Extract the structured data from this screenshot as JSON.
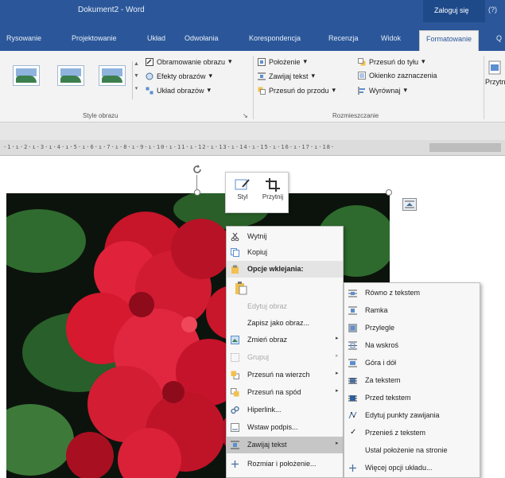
{
  "window": {
    "title": "Dokument2 - Word",
    "login_label": "Zaloguj się",
    "extra_label": "(?)"
  },
  "tabs": [
    "Rysowanie",
    "Projektowanie",
    "Układ",
    "Odwołania",
    "Korespondencja",
    "Recenzja",
    "Widok",
    "Formatowanie"
  ],
  "tab_partial": "Q",
  "ribbon": {
    "picture_styles_group": "Style obrazu",
    "arrange_group": "Rozmieszczanie",
    "border_label": "Obramowanie obrazu",
    "effects_label": "Efekty obrazów",
    "layout_label": "Układ obrazów",
    "position_label": "Położenie",
    "wrap_label": "Zawijaj tekst",
    "forward_label": "Przesuń do przodu",
    "backward_label": "Przesuń do tyłu",
    "selection_pane_label": "Okienko zaznaczenia",
    "align_label": "Wyrównaj",
    "crop_partial_label": "Przytn",
    "dropdown_suffix": "▾",
    "group_launcher": "↘"
  },
  "ruler": {
    "numbers": "·1·ı·2·ı·3·ı·4·ı·5·ı·6·ı·7·ı·8·ı·9·ı·10·ı·11·ı·12·ı·13·ı·14·ı·15·ı·16·ı·17·ı·18·"
  },
  "mini_toolbar": {
    "style_label": "Styl",
    "crop_label": "Przytnij"
  },
  "context_menu": {
    "cut": "Wytnij",
    "copy": "Kopiuj",
    "paste_options": "Opcje wklejania:",
    "edit_image": "Edytuj obraz",
    "save_as_image": "Zapisz jako obraz...",
    "change_image": "Zmień obraz",
    "group": "Grupuj",
    "bring_to_front": "Przesuń na wierzch",
    "send_to_back": "Przesuń na spód",
    "hyperlink": "Hiperlink...",
    "insert_caption": "Wstaw podpis...",
    "wrap_text": "Zawijaj tekst",
    "size_position": "Rozmiar i położenie...",
    "submenu_arrow": "▸"
  },
  "wrap_submenu": {
    "inline": "Równo z tekstem",
    "square": "Ramka",
    "tight": "Przylegle",
    "through": "Na wskroś",
    "top_bottom": "Góra i dół",
    "behind": "Za tekstem",
    "in_front": "Przed tekstem",
    "edit_wrap_points": "Edytuj punkty zawijania",
    "move_with_text": "Przenieś z tekstem",
    "fix_position": "Ustal położenie na stronie",
    "more_options": "Więcej opcji układu...",
    "check_mark": "✓"
  },
  "colors": {
    "accent": "#2b579a",
    "flower_red": "#d9182e",
    "leaf_green": "#3d7a3a"
  }
}
